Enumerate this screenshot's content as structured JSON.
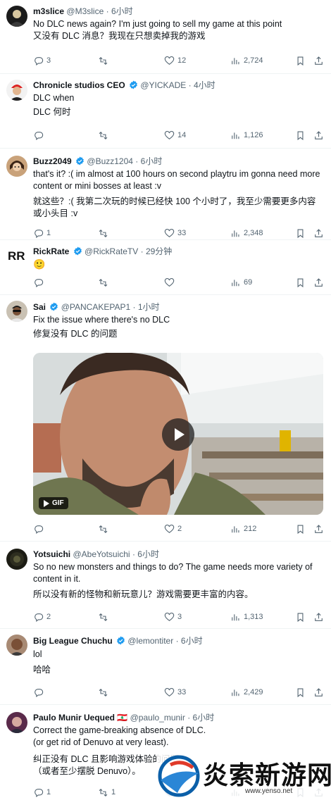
{
  "colors": {
    "verified": "#1d9bf0",
    "text": "#0f1419",
    "muted": "#536471",
    "border": "#eff3f4"
  },
  "icons": {
    "reply": "reply-icon",
    "retweet": "retweet-icon",
    "like": "heart-icon",
    "views": "views-icon",
    "bookmark": "bookmark-icon",
    "share": "share-icon"
  },
  "tweets": [
    {
      "name": "m3slice",
      "handle": "@M3slice",
      "dot": "·",
      "time": "6小时",
      "verified": false,
      "lines": [
        "No DLC news again? I'm just going to sell my game at this point",
        "又没有 DLC 消息？我现在只想卖掉我的游戏"
      ],
      "reply": "3",
      "retweet": "",
      "like": "12",
      "views": "2,724"
    },
    {
      "name": "Chronicle studios CEO",
      "handle": "@YICKADE",
      "dot": "·",
      "time": "4小时",
      "verified": true,
      "lines": [
        "DLC when",
        "DLC 何时"
      ],
      "reply": "",
      "retweet": "",
      "like": "14",
      "views": "1,126"
    },
    {
      "name": "Buzz2049",
      "handle": "@Buzz1204",
      "dot": "·",
      "time": "6小时",
      "verified": true,
      "lines": [
        "that's it? :( im almost at 100 hours on second playtru im gonna need more content or mini bosses at least :v",
        "就这些？:( 我第二次玩的时候已经快 100 个小时了，我至少需要更多内容或小头目 :v"
      ],
      "reply": "1",
      "retweet": "",
      "like": "33",
      "views": "2,348"
    },
    {
      "name": "RickRate",
      "handle": "@RickRateTV",
      "dot": "·",
      "time": "29分钟",
      "verified": true,
      "lines": [
        "🙂"
      ],
      "reply": "",
      "retweet": "",
      "like": "",
      "views": "69"
    },
    {
      "name": "Sai",
      "handle": "@PANCAKEPAP1",
      "dot": "·",
      "time": "1小时",
      "verified": true,
      "lines": [
        "Fix the issue where there's no DLC",
        "修复没有 DLC 的问题"
      ],
      "media_badge": "GIF",
      "reply": "",
      "retweet": "",
      "like": "2",
      "views": "212"
    },
    {
      "name": "Yotsuichi",
      "handle": "@AbeYotsuichi",
      "dot": "·",
      "time": "6小时",
      "verified": false,
      "lines": [
        "So no new monsters and things to do? The game needs more variety of content in it.",
        "所以没有新的怪物和新玩意儿？游戏需要更丰富的内容。"
      ],
      "reply": "2",
      "retweet": "",
      "like": "3",
      "views": "1,313"
    },
    {
      "name": "Big League Chuchu",
      "handle": "@lemontiter",
      "dot": "·",
      "time": "6小时",
      "verified": true,
      "lines": [
        "lol",
        "哈哈"
      ],
      "reply": "",
      "retweet": "",
      "like": "33",
      "views": "2,429"
    },
    {
      "name": "Paulo Munir Uequed 🇱🇧",
      "handle": "@paulo_munir",
      "dot": "·",
      "time": "6小时",
      "verified": false,
      "lines": [
        "Correct the game-breaking absence of DLC.",
        "(or get rid of Denuvo at very least).",
        "纠正没有 DLC 且影响游戏体验的问题",
        "（或者至少摆脱 Denuvo）。"
      ],
      "reply": "1",
      "retweet": "1",
      "like": "",
      "views": ""
    }
  ],
  "watermark": {
    "brand": "炎索新游网",
    "url": "www.yenso.net"
  }
}
